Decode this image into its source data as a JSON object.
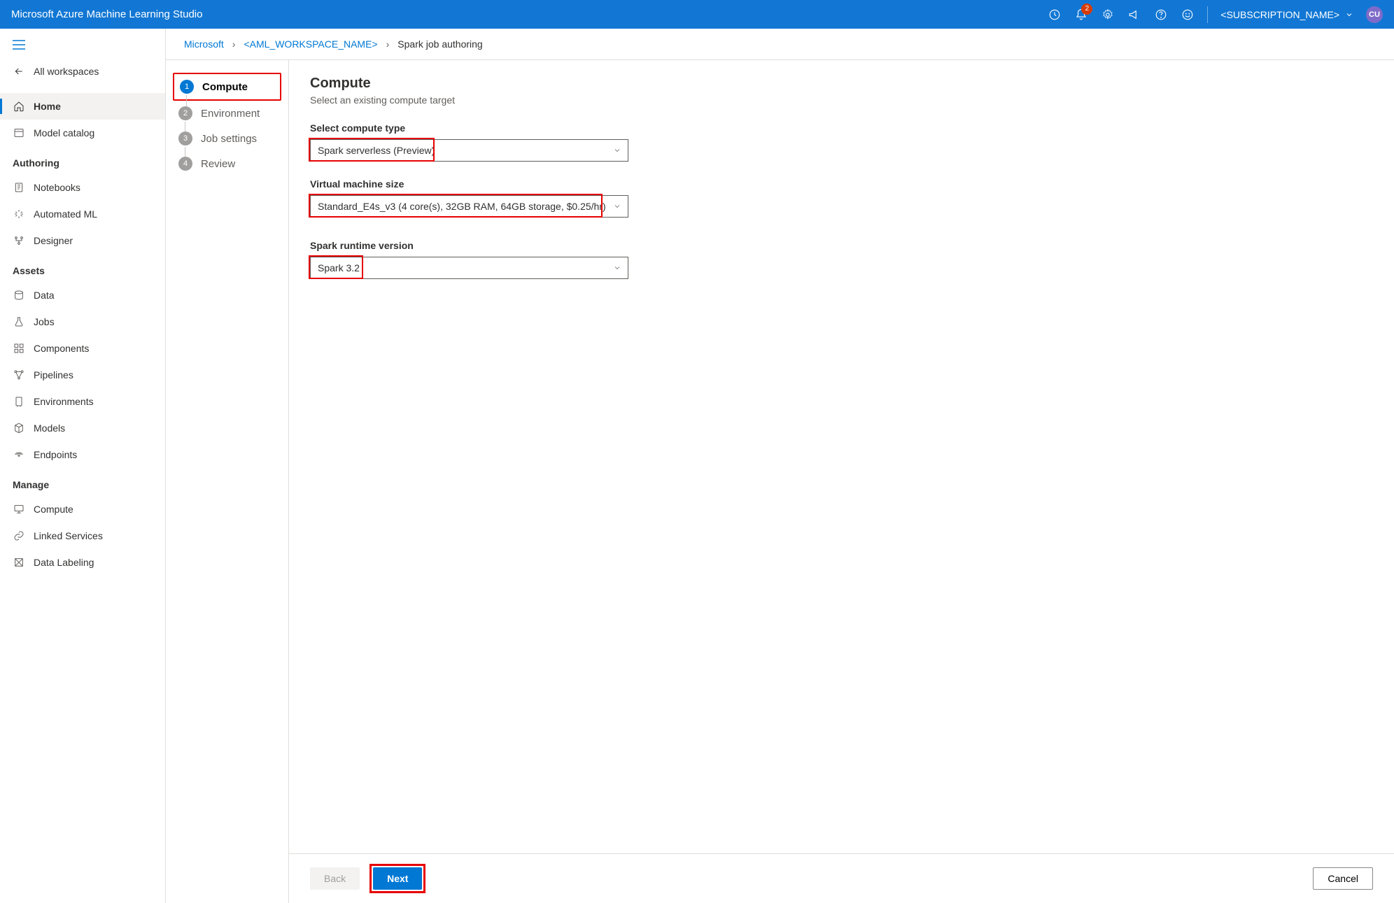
{
  "topbar": {
    "title": "Microsoft Azure Machine Learning Studio",
    "notif_count": "2",
    "subscription": "<SUBSCRIPTION_NAME>",
    "avatar": "CU"
  },
  "sidebar": {
    "all_workspaces": "All workspaces",
    "home": "Home",
    "model_catalog": "Model catalog",
    "sections": {
      "authoring": "Authoring",
      "assets": "Assets",
      "manage": "Manage"
    },
    "notebooks": "Notebooks",
    "automl": "Automated ML",
    "designer": "Designer",
    "data": "Data",
    "jobs": "Jobs",
    "components": "Components",
    "pipelines": "Pipelines",
    "environments": "Environments",
    "models": "Models",
    "endpoints": "Endpoints",
    "compute": "Compute",
    "linked": "Linked Services",
    "labeling": "Data Labeling"
  },
  "breadcrumb": {
    "root": "Microsoft",
    "workspace": "<AML_WORKSPACE_NAME>",
    "current": "Spark job authoring"
  },
  "stepper": {
    "s1": "Compute",
    "s2": "Environment",
    "s3": "Job settings",
    "s4": "Review"
  },
  "form": {
    "title": "Compute",
    "subtitle": "Select an existing compute target",
    "compute_type_label": "Select compute type",
    "compute_type_value": "Spark serverless (Preview)",
    "vm_label": "Virtual machine size",
    "vm_value": "Standard_E4s_v3 (4 core(s), 32GB RAM, 64GB storage, $0.25/hr)",
    "runtime_label": "Spark runtime version",
    "runtime_value": "Spark 3.2"
  },
  "footer": {
    "back": "Back",
    "next": "Next",
    "cancel": "Cancel"
  }
}
